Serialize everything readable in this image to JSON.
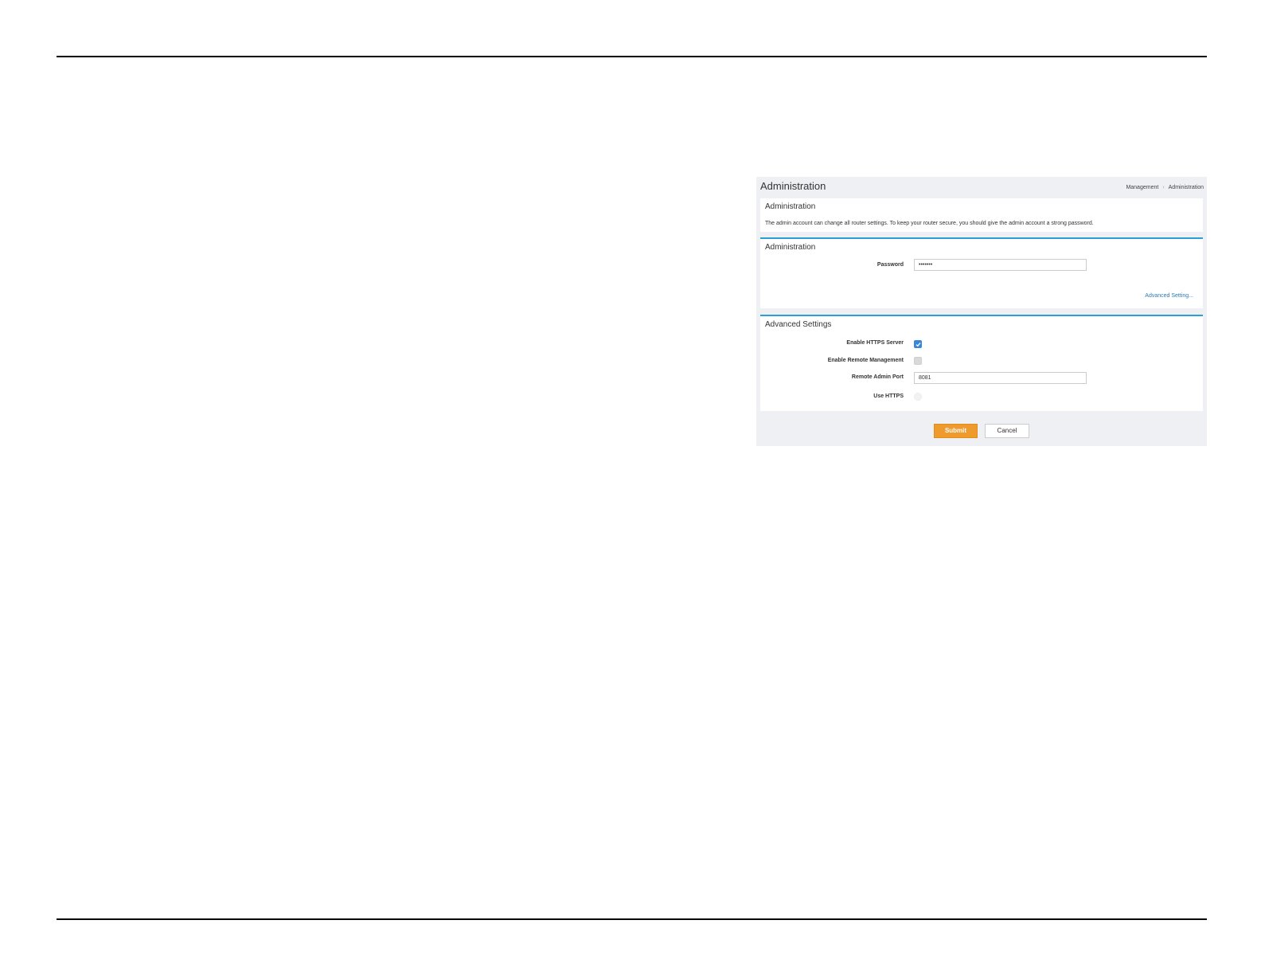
{
  "page": {
    "title": "Administration",
    "breadcrumb": [
      "Management",
      "Administration"
    ]
  },
  "intro": {
    "title": "Administration",
    "description": "The admin account can change all router settings. To keep your router secure, you should give the admin account a strong password."
  },
  "admin": {
    "title": "Administration",
    "password_label": "Password",
    "password_value": "•••••••",
    "advanced_link": "Advanced Setting..."
  },
  "advanced": {
    "title": "Advanced Settings",
    "https_server_label": "Enable HTTPS Server",
    "https_server_checked": true,
    "remote_mgmt_label": "Enable Remote Management",
    "remote_mgmt_checked": false,
    "remote_port_label": "Remote Admin Port",
    "remote_port_value": "8081",
    "use_https_label": "Use HTTPS",
    "use_https_checked": false
  },
  "actions": {
    "submit_label": "Submit",
    "cancel_label": "Cancel"
  },
  "colors": {
    "accent": "#2a9fd6",
    "submit": "#ee9a2c",
    "checkbox_checked": "#3b86d6",
    "link": "#2a7ab8"
  }
}
